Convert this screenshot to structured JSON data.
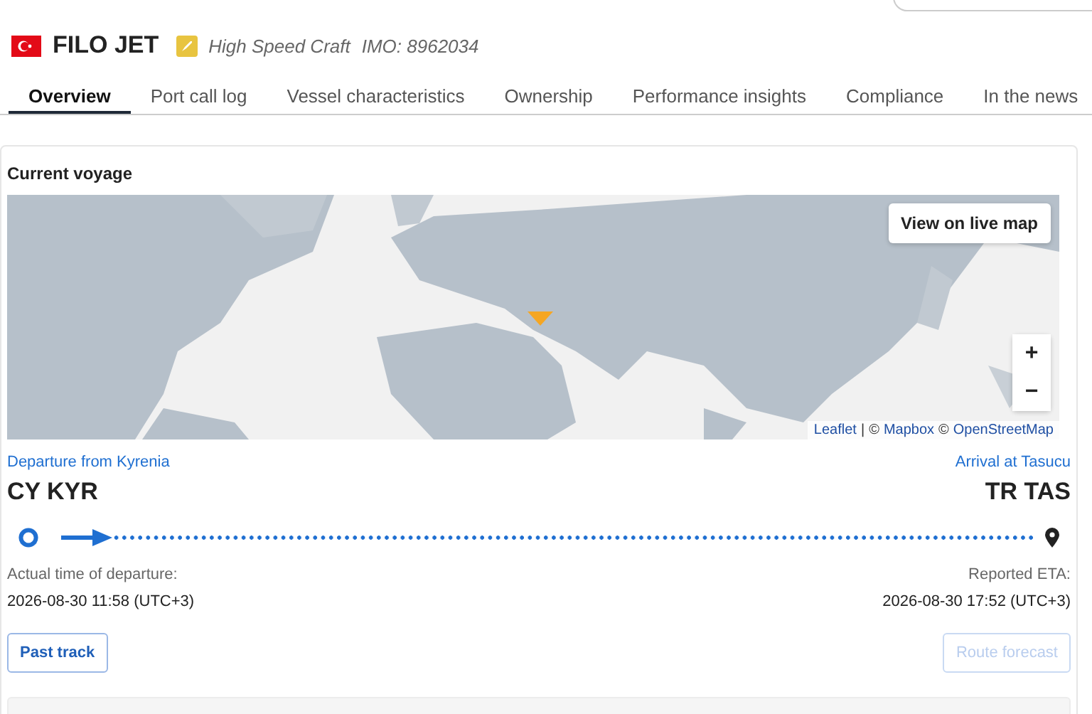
{
  "vessel": {
    "name": "FILO JET",
    "type": "High Speed Craft",
    "imo": "IMO: 8962034"
  },
  "tabs": [
    {
      "label": "Overview",
      "selected": true
    },
    {
      "label": "Port call log",
      "selected": false
    },
    {
      "label": "Vessel characteristics",
      "selected": false
    },
    {
      "label": "Ownership",
      "selected": false
    },
    {
      "label": "Performance insights",
      "selected": false
    },
    {
      "label": "Compliance",
      "selected": false
    },
    {
      "label": "In the news",
      "selected": false
    }
  ],
  "voyage": {
    "title": "Current voyage",
    "map": {
      "kind": "picture",
      "live_map_button": "View on live map",
      "zoom_in": "+",
      "zoom_out": "−",
      "attribution": [
        {
          "text": "Leaflet",
          "link": true
        },
        {
          "text": "|",
          "link": false
        },
        {
          "text": "©",
          "link": false
        },
        {
          "text": "Mapbox",
          "link": true
        },
        {
          "text": "©",
          "link": false
        },
        {
          "text": "OpenStreetMap",
          "link": true
        }
      ]
    },
    "departure": {
      "label": "Departure from Kyrenia",
      "code": "CY KYR",
      "time_label": "Actual time of departure:",
      "time": "2026-08-30 11:58 (UTC+3)"
    },
    "arrival": {
      "label": "Arrival at Tasucu",
      "code": "TR TAS",
      "time_label": "Reported ETA:",
      "time": "2026-08-30 17:52 (UTC+3)"
    },
    "buttons": [
      {
        "label": "Past track",
        "disabled": false
      },
      {
        "label": "Route forecast",
        "disabled": true
      }
    ]
  }
}
